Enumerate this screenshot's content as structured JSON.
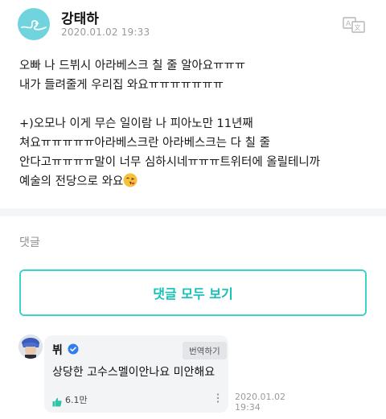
{
  "post": {
    "author": "강태하",
    "date": "2020.01.02 19:33",
    "lines": [
      "오빠 나 드뷔시 아라베스크 칠 줄 알아요ㅠㅠㅠ",
      "내가 들려줄게 우리집 와요ㅠㅠㅠㅠㅠㅠㅠ",
      "",
      "+)오모나 이게 무슨 일이람 나 피아노만 11년째",
      "쳐요ㅠㅠㅠㅠㅠ아라베스크란 아라베스크는 다 칠 줄",
      "안다고ㅠㅠㅠㅠ말이 너무 심하시네ㅠㅠㅠ트위터에 올릴테니까",
      "예술의 전당으로 와요"
    ],
    "emoji": "face-blowing-kiss-icon"
  },
  "comments": {
    "label": "댓글",
    "view_all_label": "댓글 모두 보기"
  },
  "reply": {
    "name": "뷔",
    "translate_label": "번역하기",
    "text": "상당한 고수스멜이안나요 미안해요",
    "likes": "6.1만",
    "date_line1": "2020.01.02",
    "date_line2": "19:34"
  },
  "colors": {
    "accent": "#14c0b6",
    "accent_border": "#3ed3c8",
    "logo_bg": "#6fd4dd",
    "verified": "#2f80ed",
    "like": "#2ec4a7"
  }
}
